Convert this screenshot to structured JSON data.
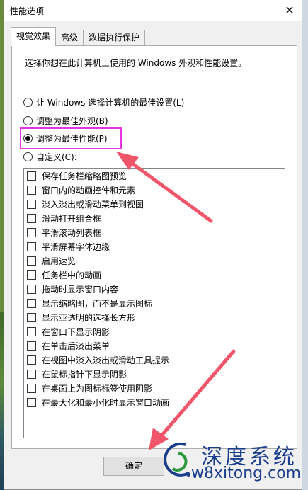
{
  "window": {
    "title": "性能选项",
    "close_glyph": "✕"
  },
  "tabs": [
    {
      "label": "视觉效果",
      "active": true
    },
    {
      "label": "高级",
      "active": false
    },
    {
      "label": "数据执行保护",
      "active": false
    }
  ],
  "description": "选择你想在此计算机上使用的 Windows 外观和性能设置。",
  "radios": [
    {
      "label": "让 Windows 选择计算机的最佳设置(L)",
      "checked": false
    },
    {
      "label": "调整为最佳外观(B)",
      "checked": false
    },
    {
      "label": "调整为最佳性能(P)",
      "checked": true
    },
    {
      "label": "自定义(C):",
      "checked": false
    }
  ],
  "effects": [
    {
      "label": "保存任务栏缩略图预览",
      "checked": false
    },
    {
      "label": "窗口内的动画控件和元素",
      "checked": false
    },
    {
      "label": "淡入淡出或滑动菜单到视图",
      "checked": false
    },
    {
      "label": "滑动打开组合框",
      "checked": false
    },
    {
      "label": "平滑滚动列表框",
      "checked": false
    },
    {
      "label": "平滑屏幕字体边缘",
      "checked": false
    },
    {
      "label": "启用速览",
      "checked": false
    },
    {
      "label": "任务栏中的动画",
      "checked": false
    },
    {
      "label": "拖动时显示窗口内容",
      "checked": false
    },
    {
      "label": "显示缩略图，而不是显示图标",
      "checked": false
    },
    {
      "label": "显示亚透明的选择长方形",
      "checked": false
    },
    {
      "label": "在窗口下显示阴影",
      "checked": false
    },
    {
      "label": "在单击后淡出菜单",
      "checked": false
    },
    {
      "label": "在视图中淡入淡出或滑动工具提示",
      "checked": false
    },
    {
      "label": "在鼠标指针下显示阴影",
      "checked": false
    },
    {
      "label": "在桌面上为图标标签使用阴影",
      "checked": false
    },
    {
      "label": "在最大化和最小化时显示窗口动画",
      "checked": false
    }
  ],
  "buttons": {
    "ok": "确定"
  },
  "watermark": {
    "title": "深度系统",
    "url": "w8xitong.com"
  },
  "colors": {
    "highlight": "#e535e0",
    "arrow": "#f0556a",
    "watermark": "#1a3d8c"
  }
}
